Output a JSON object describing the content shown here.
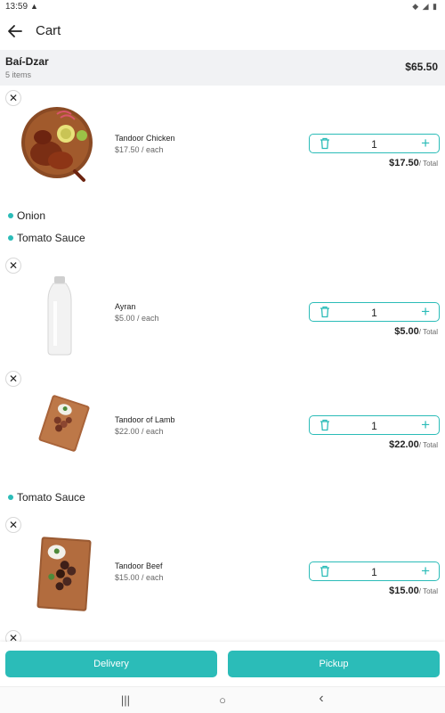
{
  "status": {
    "time": "13:59",
    "alert": "▲",
    "icons": "◆ ◢ ▮"
  },
  "header": {
    "back_icon": "arrow-left-icon",
    "title": "Cart"
  },
  "restaurant": {
    "name": "Baí-Dzar",
    "item_count": "5 items",
    "total": "$65.50"
  },
  "items": [
    {
      "name": "Tandoor Chicken",
      "unit_price": "$17.50 / each",
      "quantity": "1",
      "line_total": "$17.50",
      "total_suffix": "/ Total"
    },
    {
      "name": "Ayran",
      "unit_price": "$5.00 / each",
      "quantity": "1",
      "line_total": "$5.00",
      "total_suffix": "/ Total"
    },
    {
      "name": "Tandoor of Lamb",
      "unit_price": "$22.00 / each",
      "quantity": "1",
      "line_total": "$22.00",
      "total_suffix": "/ Total"
    },
    {
      "name": "Tandoor Beef",
      "unit_price": "$15.00 / each",
      "quantity": "1",
      "line_total": "$15.00",
      "total_suffix": "/ Total"
    }
  ],
  "options": {
    "chicken": [
      "Onion",
      "Tomato Sauce"
    ],
    "lamb": [
      "Tomato Sauce"
    ]
  },
  "actions": {
    "delivery": "Delivery",
    "pickup": "Pickup"
  },
  "nav": {
    "recents": "|||",
    "home": "○",
    "back": "‹"
  },
  "colors": {
    "accent": "#2bbcb8",
    "restaurant_bar": "#f1f2f4"
  }
}
